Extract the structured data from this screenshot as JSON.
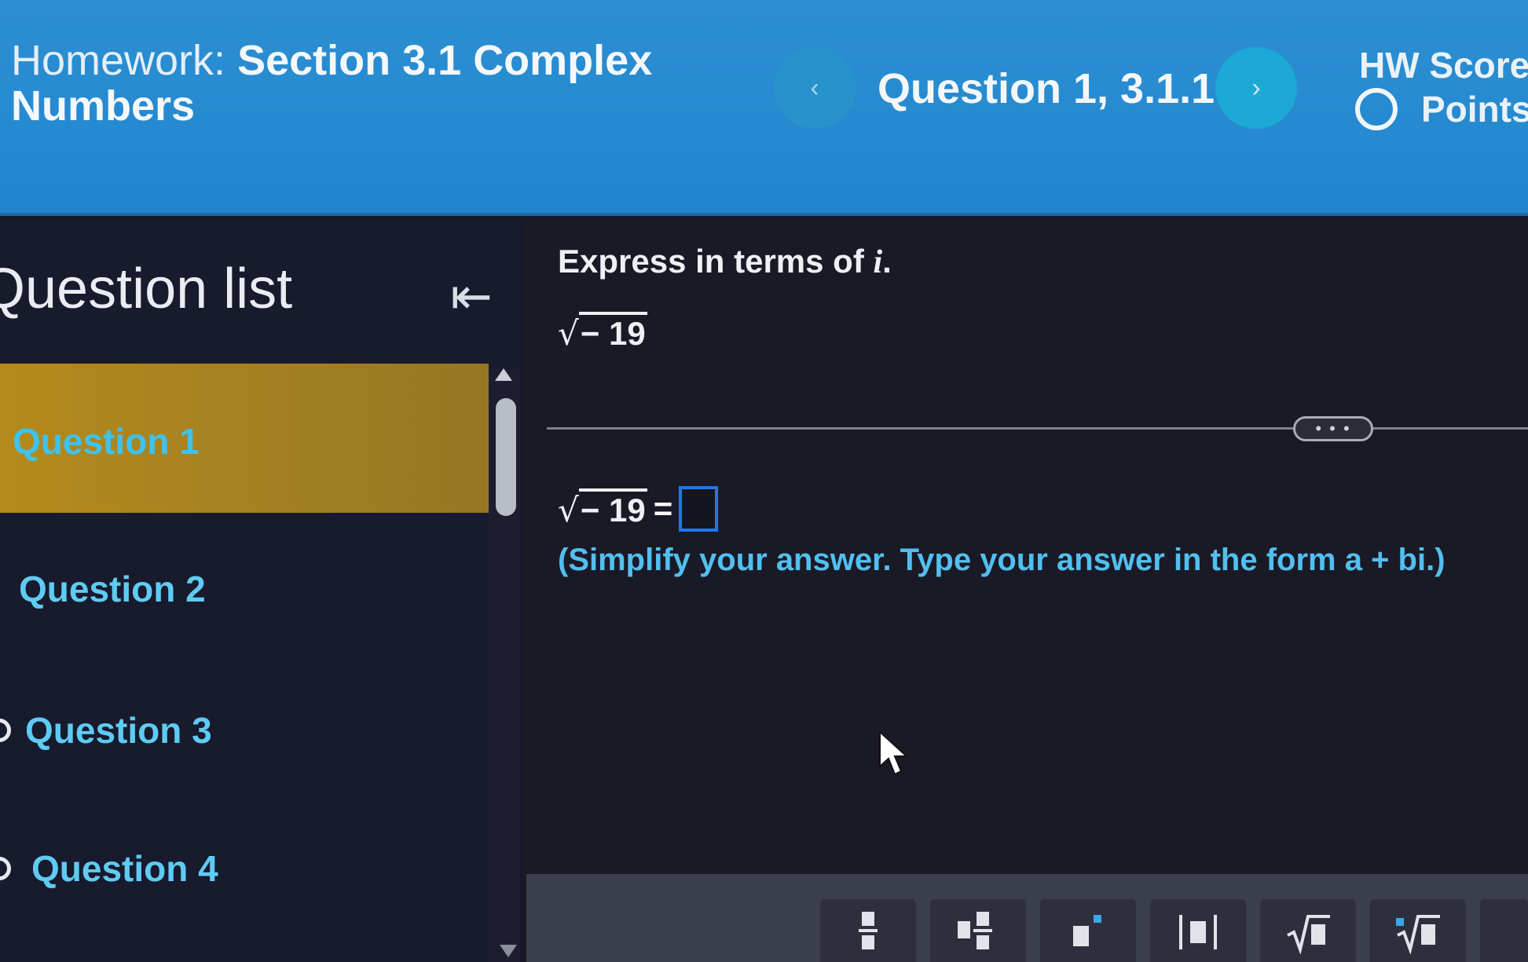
{
  "header": {
    "homework_label": "Homework:",
    "homework_name": "Section 3.1 Complex Numbers",
    "prev_icon": "‹",
    "next_icon": "›",
    "question_title": "Question 1, 3.1.1",
    "hw_score_label": "HW Score:",
    "points_label": "Points"
  },
  "sidebar": {
    "title": "Question list",
    "collapse_icon": "⇤",
    "items": [
      {
        "label": "Question 1",
        "active": true
      },
      {
        "label": "Question 2",
        "active": false
      },
      {
        "label": "Question 3",
        "active": false
      },
      {
        "label": "Question 4",
        "active": false
      }
    ]
  },
  "main": {
    "instruction_text": "Express in terms of ",
    "instruction_var": "i",
    "instruction_end": ".",
    "root_symbol": "√",
    "radicand": "− 19",
    "more_label": "• • •",
    "equals": "=",
    "hint": "(Simplify your answer. Type your answer in the form a + bi.)"
  },
  "toolbar": {
    "tools": [
      {
        "name": "fraction-tool",
        "glyph": "▪/▪"
      },
      {
        "name": "mixed-number-tool",
        "glyph": "▪▪/▪"
      },
      {
        "name": "exponent-tool",
        "glyph": "▪ⁿ"
      },
      {
        "name": "absolute-value-tool",
        "glyph": "|▪|"
      },
      {
        "name": "square-root-tool",
        "glyph": "√▪"
      },
      {
        "name": "nth-root-tool",
        "glyph": "ⁿ√▪"
      }
    ]
  },
  "colors": {
    "header_bg": "#2a8cd1",
    "active_item_bg": "#b08a1f",
    "question_text": "#5ecbf2",
    "answer_box_border": "#1f78ea"
  }
}
